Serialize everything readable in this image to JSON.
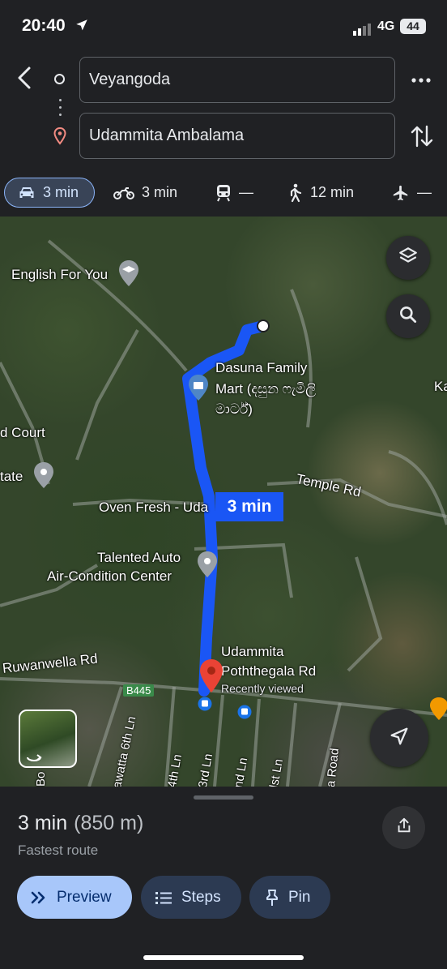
{
  "status_bar": {
    "time": "20:40",
    "network": "4G",
    "battery": "44"
  },
  "route": {
    "origin": "Veyangoda",
    "destination": "Udammita Ambalama"
  },
  "modes": [
    {
      "name": "Drive",
      "icon": "car-icon",
      "value": "3 min",
      "selected": true
    },
    {
      "name": "Motorbike",
      "icon": "motorbike-icon",
      "value": "3 min"
    },
    {
      "name": "Transit",
      "icon": "train-icon",
      "value": "—"
    },
    {
      "name": "Walk",
      "icon": "walk-icon",
      "value": "12 min"
    },
    {
      "name": "Flight",
      "icon": "flight-icon",
      "value": "—"
    }
  ],
  "map": {
    "route_badge": "3 min",
    "labels": {
      "english_for_you": "English For You",
      "dasuna_line1": "Dasuna Family",
      "dasuna_line2": "Mart (දසුන ෆැමිලි",
      "dasuna_line3": "මාර්ට්)",
      "court": "d Court",
      "estate": "tate",
      "temple_rd": "Temple Rd",
      "oven_fresh": "Oven Fresh - Uda",
      "talented_line1": "Talented Auto",
      "talented_line2": "Air-Condition Center",
      "udammita_line1": "Udammita",
      "udammita_line2": "Poththegala Rd",
      "recently_viewed": "Recently viewed",
      "ruwanwella_rd": "Ruwanwella Rd",
      "b445": "B445",
      "ka": "Ka",
      "bo": "Bo",
      "awatta_6th": "awatta 6th Ln",
      "ln_4th": "4th Ln",
      "ln_3rd": "3rd Ln",
      "ln_2nd": "nd Ln",
      "ln_1st": "lst Ln",
      "a_road": "a Road"
    }
  },
  "sheet": {
    "duration": "3 min",
    "distance": "(850 m)",
    "subtitle": "Fastest route",
    "preview_label": "Preview",
    "steps_label": "Steps",
    "pin_label": "Pin"
  },
  "colors": {
    "route": "#1a56f5",
    "accent": "#a8c7fa",
    "destination_pin": "#ea4335"
  }
}
